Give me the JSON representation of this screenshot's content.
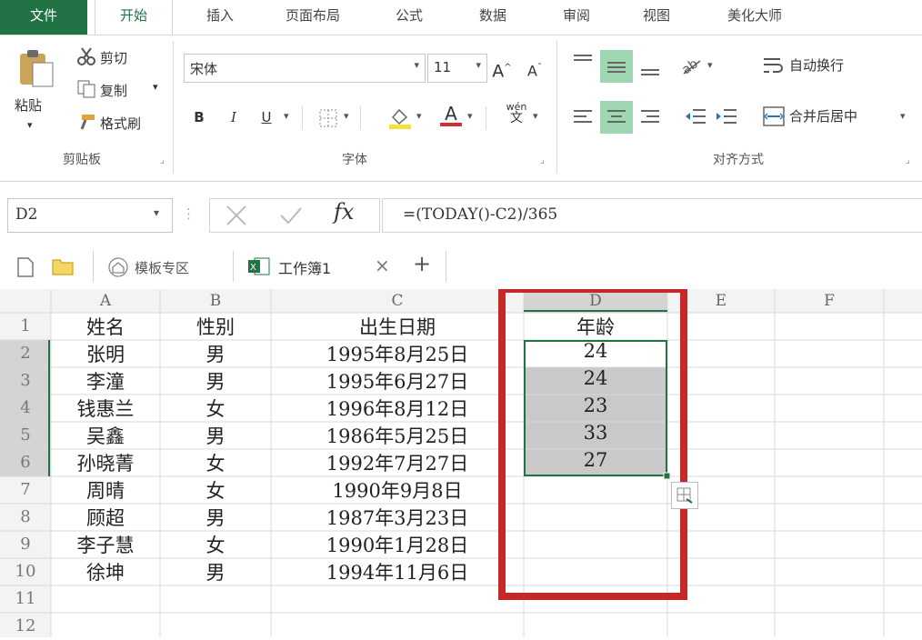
{
  "menu": {
    "file": "文件",
    "tabs": [
      "开始",
      "插入",
      "页面布局",
      "公式",
      "数据",
      "审阅",
      "视图",
      "美化大师"
    ]
  },
  "ribbon": {
    "clipboard": {
      "paste": "粘贴",
      "cut": "剪切",
      "copy": "复制",
      "format_painter": "格式刷",
      "label": "剪贴板"
    },
    "font": {
      "name": "宋体",
      "size": "11",
      "grow": "A",
      "shrink": "A",
      "bold": "B",
      "italic": "I",
      "underline": "U",
      "phonetic_top": "wén",
      "phonetic_bottom": "文",
      "font_color_glyph": "A",
      "label": "字体"
    },
    "align": {
      "wrap": "自动换行",
      "merge": "合并后居中",
      "label": "对齐方式"
    }
  },
  "formula_bar": {
    "name_box": "D2",
    "fx": "fx",
    "formula": "=(TODAY()-C2)/365"
  },
  "tabbar": {
    "template": "模板专区",
    "workbook": "工作簿1",
    "close": "×",
    "add": "+"
  },
  "columns": [
    "A",
    "B",
    "C",
    "D",
    "E",
    "F"
  ],
  "rows": [
    {
      "num": "1",
      "a": "姓名",
      "b": "性别",
      "c": "出生日期",
      "d": "年龄"
    },
    {
      "num": "2",
      "a": "张明",
      "b": "男",
      "c": "1995年8月25日",
      "d": "24"
    },
    {
      "num": "3",
      "a": "李潼",
      "b": "男",
      "c": "1995年6月27日",
      "d": "24"
    },
    {
      "num": "4",
      "a": "钱惠兰",
      "b": "女",
      "c": "1996年8月12日",
      "d": "23"
    },
    {
      "num": "5",
      "a": "吴鑫",
      "b": "男",
      "c": "1986年5月25日",
      "d": "33"
    },
    {
      "num": "6",
      "a": "孙晓菁",
      "b": "女",
      "c": "1992年7月27日",
      "d": "27"
    },
    {
      "num": "7",
      "a": "周晴",
      "b": "女",
      "c": "1990年9月8日",
      "d": ""
    },
    {
      "num": "8",
      "a": "顾超",
      "b": "男",
      "c": "1987年3月23日",
      "d": ""
    },
    {
      "num": "9",
      "a": "李子慧",
      "b": "女",
      "c": "1990年1月28日",
      "d": ""
    },
    {
      "num": "10",
      "a": "徐坤",
      "b": "男",
      "c": "1994年11月6日",
      "d": ""
    },
    {
      "num": "11",
      "a": "",
      "b": "",
      "c": "",
      "d": ""
    },
    {
      "num": "12",
      "a": "",
      "b": "",
      "c": "",
      "d": ""
    }
  ],
  "colors": {
    "excel_green": "#217346",
    "highlight_red": "#c62828",
    "selection_gray": "#c9c9c9",
    "selection_border": "#217346"
  }
}
